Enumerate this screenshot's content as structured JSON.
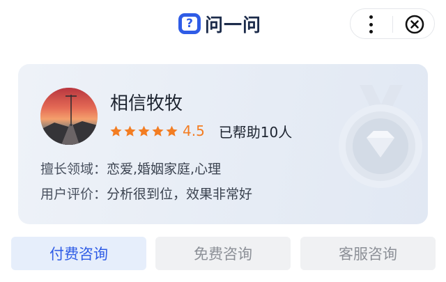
{
  "header": {
    "logo_mark": "?",
    "logo_text": "问一问",
    "more_icon": "more-dots-icon",
    "close_icon": "close-circle-icon"
  },
  "card": {
    "name": "相信牧牧",
    "rating": {
      "stars": 5,
      "score": "4.5",
      "helped": "已帮助10人"
    },
    "expertise": {
      "label": "擅长领域：",
      "value": "恋爱,婚姻家庭,心理"
    },
    "review": {
      "label": "用户评价：",
      "value": "分析很到位，效果非常好"
    },
    "badge_icon": "diamond-medal-icon"
  },
  "buttons": {
    "paid": "付费咨询",
    "free": "免费咨询",
    "service": "客服咨询"
  },
  "colors": {
    "brand_blue": "#2f5ce6",
    "star_orange": "#f37d22",
    "card_bg": "#e8edf6"
  }
}
